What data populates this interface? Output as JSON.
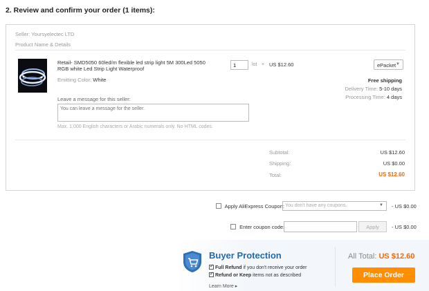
{
  "section_title": "2. Review and confirm your order (1 items):",
  "seller": "Seller: Yoursyelectec LTD",
  "product_header": "Product Name & Details",
  "product": {
    "title": "Retail- SMD5050 60led/m flexible led strip light 5M 300Led 5050 RGB white Led Strip Light Waterproof",
    "color_label": "Emitting Color:",
    "color_value": "White",
    "quantity": "1",
    "unit": "lot",
    "times": "×",
    "unit_price": "US $12.60",
    "shipping_method": "ePacket",
    "free_shipping": "Free shipping",
    "delivery_label": "Delivery Time:",
    "delivery_value": "5-10 days",
    "processing_label": "Processing Time:",
    "processing_value": "4 days"
  },
  "message": {
    "label": "Leave a message for this seller:",
    "placeholder": "You can leave a message for the seller.",
    "note": "Max. 1,000 English characters or Arabic numerals only. No HTML codes."
  },
  "summary": {
    "subtotal_label": "Subtotal:",
    "subtotal_value": "US $12.60",
    "shipping_label": "Shipping:",
    "shipping_value": "US $0.00",
    "total_label": "Total:",
    "total_value": "US $12.60"
  },
  "coupons": {
    "aliexpress_label": "Apply AliExpress Coupon:",
    "aliexpress_placeholder": "You don't have any coupons.",
    "aliexpress_value": "- US $0.00",
    "code_label": "Enter coupon code:",
    "apply_label": "Apply",
    "code_value": "- US $0.00"
  },
  "buyer_protection": {
    "title": "Buyer Protection",
    "line1_bold": "Full Refund",
    "line1_rest": " if you don't receive your order",
    "line2_bold": "Refund or Keep",
    "line2_rest": " items not as described",
    "learn_more": "Learn More",
    "learn_arrow": "▸"
  },
  "checkout": {
    "all_total_label": "All Total:",
    "all_total_value": "US $12.60",
    "place_order": "Place Order"
  },
  "colors": {
    "accent_orange": "#ff8e00",
    "price_orange": "#ff6600",
    "protection_blue": "#1f6ab0"
  }
}
